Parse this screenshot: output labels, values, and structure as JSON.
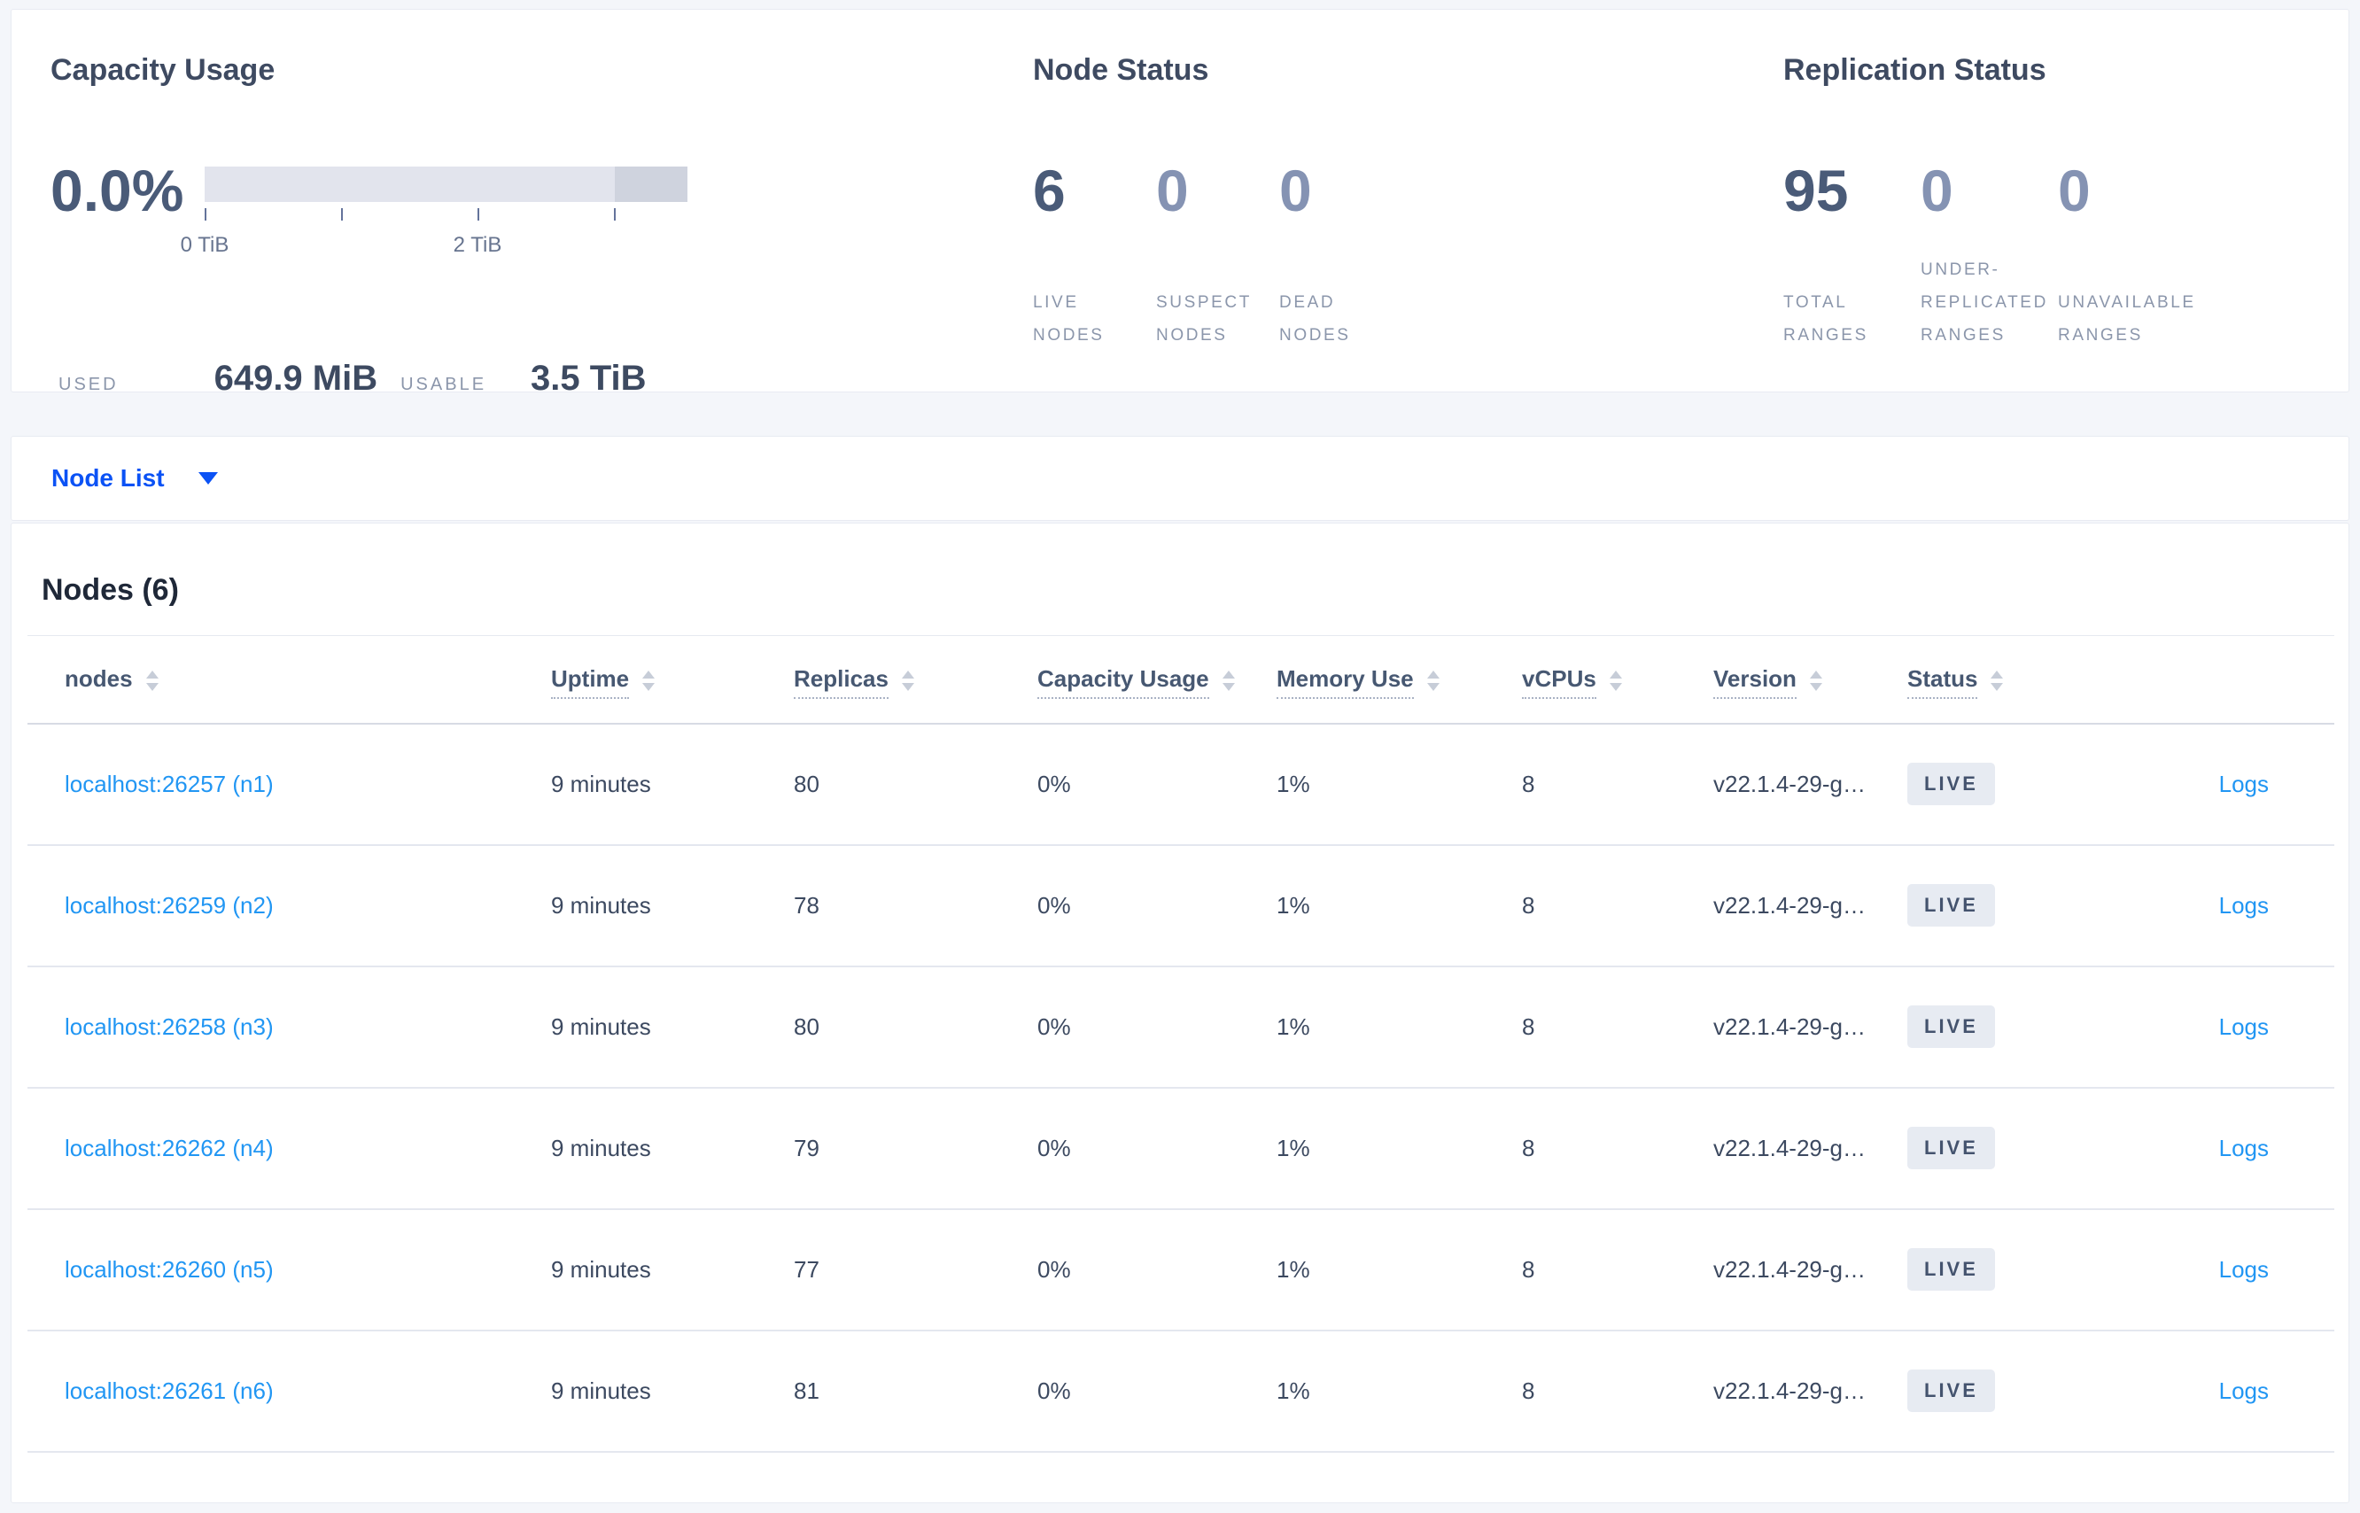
{
  "overview": {
    "capacity": {
      "title": "Capacity Usage",
      "percent": "0.0%",
      "axis_ticks": [
        {
          "label": "0 TiB"
        },
        {
          "label": ""
        },
        {
          "label": "2 TiB"
        },
        {
          "label": ""
        }
      ],
      "bar_segments": [
        {
          "name": "usable-capacity",
          "color": "#e2e4ed",
          "fraction": 0.85
        },
        {
          "name": "other-capacity",
          "color": "#cfd3de",
          "fraction": 0.15
        }
      ],
      "used_label": "USED",
      "used_value": "649.9 MiB",
      "usable_label": "USABLE",
      "usable_value": "3.5 TiB"
    },
    "node_status": {
      "title": "Node Status",
      "stats": [
        {
          "value": "6",
          "label": "LIVE NODES",
          "muted": false
        },
        {
          "value": "0",
          "label": "SUSPECT NODES",
          "muted": true
        },
        {
          "value": "0",
          "label": "DEAD NODES",
          "muted": true
        }
      ]
    },
    "replication": {
      "title": "Replication Status",
      "stats": [
        {
          "value": "95",
          "label": "TOTAL RANGES",
          "muted": false
        },
        {
          "value": "0",
          "label": "UNDER-REPLICATED RANGES",
          "muted": true
        },
        {
          "value": "0",
          "label": "UNAVAILABLE RANGES",
          "muted": true
        }
      ]
    }
  },
  "view_selector": {
    "label": "Node List"
  },
  "nodes_section": {
    "heading": "Nodes (6)",
    "table": {
      "columns": [
        {
          "label": "nodes",
          "field": "node",
          "underline": false,
          "sortable": true
        },
        {
          "label": "Uptime",
          "field": "uptime",
          "underline": true,
          "sortable": true
        },
        {
          "label": "Replicas",
          "field": "replicas",
          "underline": true,
          "sortable": true
        },
        {
          "label": "Capacity Usage",
          "field": "capacity_usage",
          "underline": true,
          "sortable": true
        },
        {
          "label": "Memory Use",
          "field": "memory_use",
          "underline": true,
          "sortable": true
        },
        {
          "label": "vCPUs",
          "field": "vcpus",
          "underline": true,
          "sortable": true
        },
        {
          "label": "Version",
          "field": "version",
          "underline": true,
          "sortable": true
        },
        {
          "label": "Status",
          "field": "status",
          "underline": true,
          "sortable": true
        },
        {
          "label": "",
          "field": "logs",
          "underline": false,
          "sortable": false
        }
      ],
      "rows": [
        {
          "node": "localhost:26257 (n1)",
          "uptime": "9 minutes",
          "replicas": "80",
          "capacity_usage": "0%",
          "memory_use": "1%",
          "vcpus": "8",
          "version": "v22.1.4-29-g…",
          "status": "LIVE",
          "logs": "Logs"
        },
        {
          "node": "localhost:26259 (n2)",
          "uptime": "9 minutes",
          "replicas": "78",
          "capacity_usage": "0%",
          "memory_use": "1%",
          "vcpus": "8",
          "version": "v22.1.4-29-g…",
          "status": "LIVE",
          "logs": "Logs"
        },
        {
          "node": "localhost:26258 (n3)",
          "uptime": "9 minutes",
          "replicas": "80",
          "capacity_usage": "0%",
          "memory_use": "1%",
          "vcpus": "8",
          "version": "v22.1.4-29-g…",
          "status": "LIVE",
          "logs": "Logs"
        },
        {
          "node": "localhost:26262 (n4)",
          "uptime": "9 minutes",
          "replicas": "79",
          "capacity_usage": "0%",
          "memory_use": "1%",
          "vcpus": "8",
          "version": "v22.1.4-29-g…",
          "status": "LIVE",
          "logs": "Logs"
        },
        {
          "node": "localhost:26260 (n5)",
          "uptime": "9 minutes",
          "replicas": "77",
          "capacity_usage": "0%",
          "memory_use": "1%",
          "vcpus": "8",
          "version": "v22.1.4-29-g…",
          "status": "LIVE",
          "logs": "Logs"
        },
        {
          "node": "localhost:26261 (n6)",
          "uptime": "9 minutes",
          "replicas": "81",
          "capacity_usage": "0%",
          "memory_use": "1%",
          "vcpus": "8",
          "version": "v22.1.4-29-g…",
          "status": "LIVE",
          "logs": "Logs"
        }
      ]
    }
  },
  "colors": {
    "accent_blue": "#0b52f5",
    "link_blue": "#2196f3",
    "badge_bg": "#e7ebf2",
    "badge_text": "#44536e",
    "bar_light": "#e2e4ed",
    "bar_dark": "#cfd3de",
    "page_bg": "#f4f6fa"
  }
}
